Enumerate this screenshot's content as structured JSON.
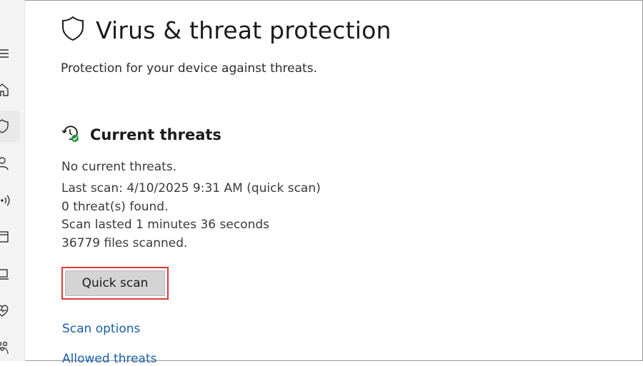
{
  "header": {
    "title": "Virus & threat protection",
    "subtitle": "Protection for your device against threats.",
    "icon": "shield-icon"
  },
  "current_threats": {
    "title": "Current threats",
    "icon": "history-check-icon",
    "status_lines": [
      "No current threats.",
      "Last scan: 4/10/2025 9:31 AM (quick scan)",
      "0 threat(s) found.",
      "Scan lasted 1 minutes 36 seconds",
      "36779 files scanned."
    ],
    "quick_scan_label": "Quick scan",
    "highlight_color": "#d9393b"
  },
  "links": {
    "scan_options": "Scan options",
    "allowed_threats": "Allowed threats"
  },
  "sidebar": {
    "items": [
      "menu-icon",
      "home-icon",
      "shield-icon",
      "account-icon",
      "network-icon",
      "app-browser-icon",
      "device-security-icon",
      "health-icon",
      "family-icon"
    ],
    "selected": "shield-icon"
  },
  "colors": {
    "link": "#1a5ea8",
    "button": "#d4d4d4"
  }
}
